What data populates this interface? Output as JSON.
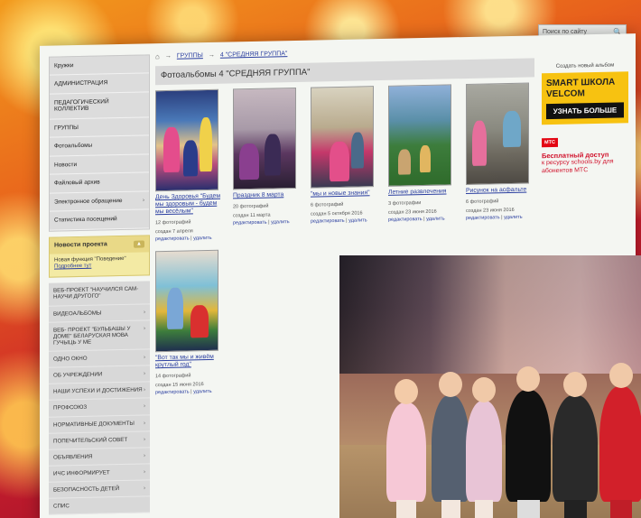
{
  "search": {
    "placeholder": "Поиск по сайту"
  },
  "sidebar": {
    "items": [
      {
        "label": "Кружки"
      },
      {
        "label": "Администрация"
      },
      {
        "label": "Педагогический коллектив"
      },
      {
        "label": "Группы"
      },
      {
        "label": "Фотоальбомы"
      },
      {
        "label": "Новости"
      },
      {
        "label": "Файловый архив"
      },
      {
        "label": "Электронное обращение"
      },
      {
        "label": "Статистика посещений"
      }
    ],
    "news": {
      "title": "Новости проекта",
      "text": "Новая функция \"Поведение\"",
      "more": "Подробнее тут"
    },
    "items2": [
      {
        "label": "ВЕБ-ПРОЕКТ \"Научился сам-научи другого\""
      },
      {
        "label": "ВИДЕОАЛЬБОМЫ"
      },
      {
        "label": "ВЕБ- ПРОЕКТ \"БУЛЬБАШЫ У ДОМЕ\" БЕЛАРУСКАЯ МОВА ГУЧЫЦЬ У МЕ"
      },
      {
        "label": "ОДНО ОКНО"
      },
      {
        "label": "ОБ УЧРЕЖДЕНИИ"
      },
      {
        "label": "НАШИ УСПЕХИ И ДОСТИЖЕНИЯ"
      },
      {
        "label": "ПРОФСОЮЗ"
      },
      {
        "label": "НОРМАТИВНЫЕ ДОКУМЕНТЫ"
      },
      {
        "label": "ПОПЕЧИТЕЛЬСКИЙ СОВЕТ"
      },
      {
        "label": "ОБЪЯВЛЕНИЯ"
      },
      {
        "label": "ИЧС ИНФОРМИРУЕТ"
      },
      {
        "label": "БЕЗОПАСНОСТЬ ДЕТЕЙ"
      },
      {
        "label": "СПИС"
      }
    ]
  },
  "breadcrumb": {
    "groups": "ГРУППЫ",
    "current": "4 \"СРЕДНЯЯ ГРУППА\""
  },
  "page_title": "Фотоальбомы 4 \"СРЕДНЯЯ ГРУППА\"",
  "albums": [
    {
      "title": "День Здоровья \"Будем мы здоровым - будем мы весёлым\"",
      "count": "12 фотографий",
      "created": "создан 7 апреля",
      "edit": "редактировать",
      "delete": "удалить"
    },
    {
      "title": "Праздник 8 марта",
      "count": "20 фотографий",
      "created": "создан 11 марта",
      "edit": "редактировать",
      "delete": "удалить"
    },
    {
      "title": "\"мы и новые знания\"",
      "count": "6 фотографий",
      "created": "создан 5 октября 2016",
      "edit": "редактировать",
      "delete": "удалить"
    },
    {
      "title": "Летние развлечения",
      "count": "3 фотографии",
      "created": "создан 23 июня 2016",
      "edit": "редактировать",
      "delete": "удалить"
    },
    {
      "title": "Рисунок на асфальте",
      "count": "6 фотографий",
      "created": "создан 23 июня 2016",
      "edit": "редактировать",
      "delete": "удалить"
    },
    {
      "title": "\"Вот так мы и живём крутлый год\"",
      "count": "14 фотографий",
      "created": "создан 15 июня 2016",
      "edit": "редактировать",
      "delete": "удалить"
    }
  ],
  "right": {
    "create_album": "Создать новый альбом",
    "velcom_title": "SMART ШКОЛА VELCOM",
    "velcom_button": "УЗНАТЬ БОЛЬШЕ",
    "mts_logo": "МТС",
    "mts_title": "Бесплатный доступ",
    "mts_text": "к ресурсу schools.by для абонентов МТС"
  }
}
